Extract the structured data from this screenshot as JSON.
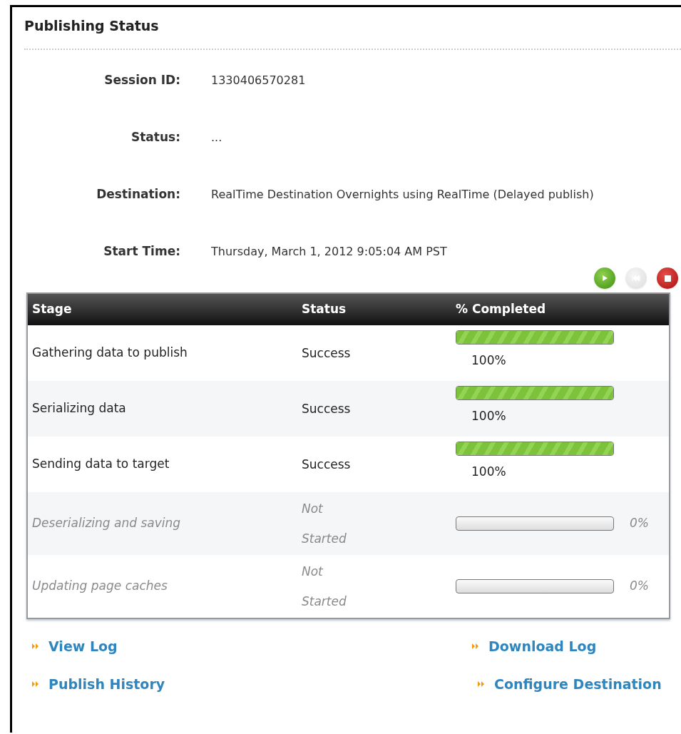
{
  "panel": {
    "title": "Publishing Status"
  },
  "details": [
    {
      "label": "Session ID:",
      "value": "1330406570281"
    },
    {
      "label": "Status:",
      "value": "..."
    },
    {
      "label": "Destination:",
      "value": "RealTime Destination Overnights using RealTime (Delayed publish)"
    },
    {
      "label": "Start Time:",
      "value": "Thursday, March 1, 2012 9:05:04 AM PST"
    }
  ],
  "controls": [
    {
      "kind": "play",
      "disabled": false
    },
    {
      "kind": "skip",
      "disabled": true
    },
    {
      "kind": "stop",
      "disabled": false
    }
  ],
  "table": {
    "columns": [
      "Stage",
      "Status",
      "% Completed"
    ],
    "rows": [
      {
        "stage": "Gathering data to publish",
        "status": "Success",
        "level": 1,
        "percent": "100%",
        "disabled": false
      },
      {
        "stage": "Serializing data",
        "status": "Success",
        "level": 1,
        "percent": "100%",
        "disabled": false
      },
      {
        "stage": "Sending data to target",
        "status": "Success",
        "level": 1,
        "percent": "100%",
        "disabled": false
      },
      {
        "stage": "Deserializing and saving",
        "status": "Not Started",
        "level": 0,
        "percent": "0%",
        "disabled": true
      },
      {
        "stage": "Updating page caches",
        "status": "Not Started",
        "level": 0,
        "percent": "0%",
        "disabled": true
      }
    ]
  },
  "links": [
    {
      "label": "View Log"
    },
    {
      "label": "Download Log"
    },
    {
      "label": "Publish History"
    },
    {
      "label": "Configure Destination"
    }
  ]
}
